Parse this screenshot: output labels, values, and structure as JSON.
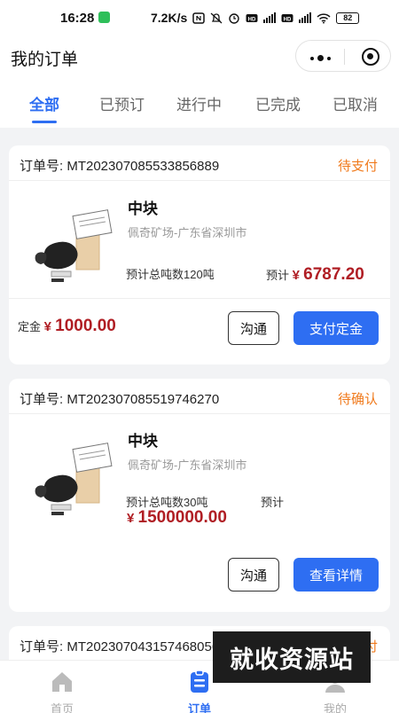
{
  "statusbar": {
    "time": "16:28",
    "net_speed": "7.2K/s",
    "battery": "82"
  },
  "navbar": {
    "title": "我的订单"
  },
  "tabs": [
    {
      "label": "全部",
      "active": true
    },
    {
      "label": "已预订",
      "active": false
    },
    {
      "label": "进行中",
      "active": false
    },
    {
      "label": "已完成",
      "active": false
    },
    {
      "label": "已取消",
      "active": false
    }
  ],
  "orders": [
    {
      "order_label": "订单号:",
      "order_no": "MT202307085533856889",
      "status": "待支付",
      "product": "中块",
      "location": "佩奇矿场-广东省深圳市",
      "tons": "预计总吨数120吨",
      "est_label": "预计",
      "currency": "¥",
      "est_amount": "6787.20",
      "deposit_label": "定金",
      "deposit_amount": "1000.00",
      "btn_contact": "沟通",
      "btn_action": "支付定金"
    },
    {
      "order_label": "订单号:",
      "order_no": "MT202307085519746270",
      "status": "待确认",
      "product": "中块",
      "location": "佩奇矿场-广东省深圳市",
      "tons": "预计总吨数30吨",
      "est_label": "预计",
      "currency": "¥",
      "est_amount": "1500000.00",
      "btn_contact": "沟通",
      "btn_action": "查看详情"
    },
    {
      "order_label": "订单号:",
      "order_no": "MT202307043157468056",
      "status": "待支付"
    }
  ],
  "tabbar": [
    {
      "label": "首页",
      "icon": "home-icon",
      "active": false
    },
    {
      "label": "订单",
      "icon": "order-icon",
      "active": true
    },
    {
      "label": "我的",
      "icon": "user-icon",
      "active": false
    }
  ],
  "watermark": "就收资源站",
  "colors": {
    "accent": "#2e6ef2",
    "status": "#f07a1c",
    "price": "#b01e24"
  }
}
